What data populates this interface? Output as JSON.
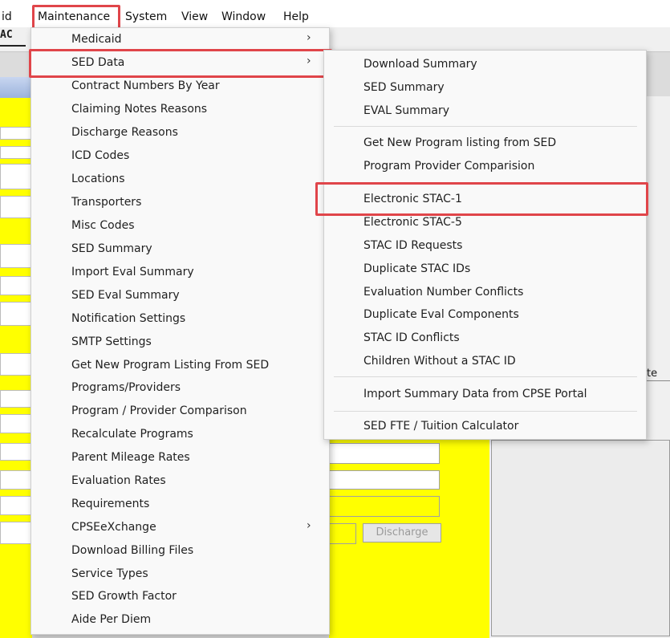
{
  "menubar": {
    "items": [
      "id",
      "Maintenance",
      "System",
      "View",
      "Window",
      "Help"
    ]
  },
  "background": {
    "toolbar_label": "AC",
    "discharge_button": "Discharge",
    "right_panel_label": "te"
  },
  "maintenance_menu": {
    "items": [
      {
        "label": "Medicaid",
        "submenu": true
      },
      {
        "label": "SED Data",
        "submenu": true
      },
      {
        "label": "Contract Numbers By Year"
      },
      {
        "label": "Claiming Notes Reasons"
      },
      {
        "label": "Discharge Reasons"
      },
      {
        "label": "ICD Codes"
      },
      {
        "label": "Locations"
      },
      {
        "label": "Transporters"
      },
      {
        "label": "Misc Codes"
      },
      {
        "label": "SED Summary"
      },
      {
        "label": "Import Eval Summary"
      },
      {
        "label": "SED Eval Summary"
      },
      {
        "label": "Notification Settings"
      },
      {
        "label": "SMTP Settings"
      },
      {
        "label": "Get New Program Listing From SED"
      },
      {
        "label": "Programs/Providers"
      },
      {
        "label": "Program / Provider Comparison"
      },
      {
        "label": "Recalculate Programs"
      },
      {
        "label": "Parent Mileage Rates"
      },
      {
        "label": "Evaluation Rates"
      },
      {
        "label": "Requirements"
      },
      {
        "label": "CPSEeXchange",
        "submenu": true
      },
      {
        "label": "Download Billing Files"
      },
      {
        "label": "Service Types"
      },
      {
        "label": "SED Growth Factor"
      },
      {
        "label": "Aide Per Diem"
      }
    ],
    "arrow_glyph": "›"
  },
  "sed_data_submenu": {
    "items": [
      "Download Summary",
      "SED Summary",
      "EVAL Summary",
      "Get New Program listing from SED",
      "Program Provider Comparision",
      "Electronic STAC-1",
      "Electronic STAC-5",
      "STAC ID Requests",
      "Duplicate STAC IDs",
      "Evaluation Number Conflicts",
      "Duplicate Eval Components",
      "STAC ID Conflicts",
      "Children Without a STAC ID",
      "Import Summary Data from CPSE Portal",
      "SED FTE / Tuition Calculator"
    ]
  },
  "highlight_color": "#e0454a"
}
